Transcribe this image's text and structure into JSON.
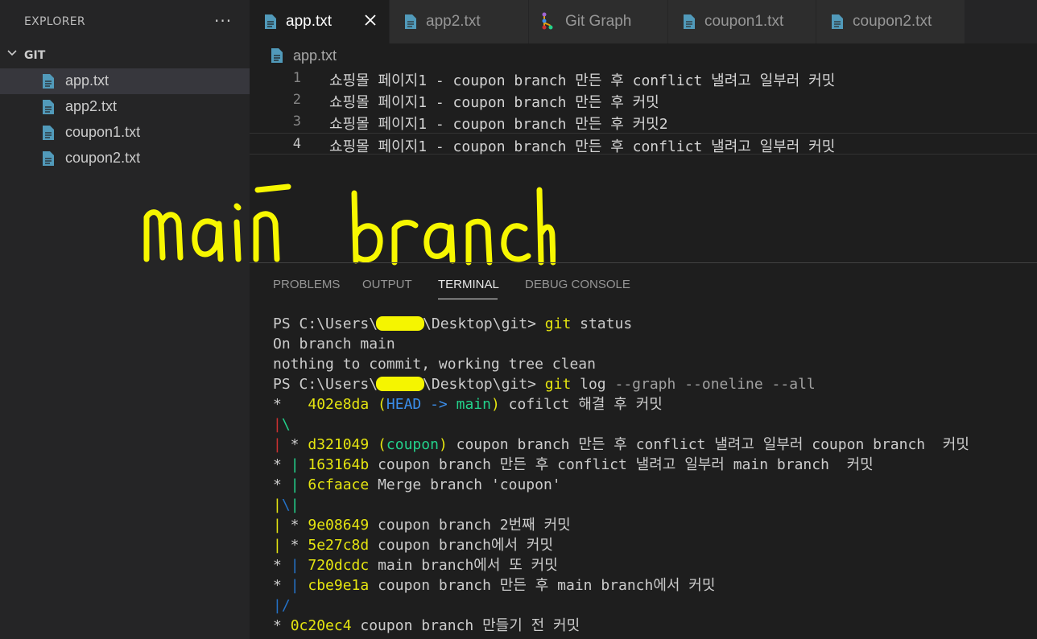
{
  "sidebar": {
    "title": "EXPLORER",
    "more": "···",
    "section": "GIT",
    "files": [
      "app.txt",
      "app2.txt",
      "coupon1.txt",
      "coupon2.txt"
    ]
  },
  "tabs": [
    "app.txt",
    "app2.txt",
    "Git Graph",
    "coupon1.txt",
    "coupon2.txt"
  ],
  "breadcrumb": "app.txt",
  "editor": {
    "lines": [
      {
        "n": "1",
        "text": "쇼핑몰 페이지1 - coupon branch 만든 후 conflict 낼려고 일부러 커밋"
      },
      {
        "n": "2",
        "text": "쇼핑몰 페이지1 - coupon branch 만든 후 커밋"
      },
      {
        "n": "3",
        "text": "쇼핑몰 페이지1 - coupon branch 만든 후 커밋2"
      },
      {
        "n": "4",
        "text": "쇼핑몰 페이지1 - coupon branch 만든 후 conflict 낼려고 일부러 커밋"
      }
    ]
  },
  "panel": {
    "tabs": [
      "PROBLEMS",
      "OUTPUT",
      "TERMINAL",
      "DEBUG CONSOLE"
    ],
    "active": "TERMINAL"
  },
  "terminal": {
    "prompt_pre": "PS C:\\Users\\",
    "prompt_post": "\\Desktop\\git>",
    "cmd1_git": "git",
    "cmd1_rest": " status",
    "out1": "On branch main",
    "out2": "nothing to commit, working tree clean",
    "cmd2_git": "git",
    "cmd2_log": " log",
    "cmd2_rest": " --graph --oneline --all",
    "g1_star": "*   ",
    "g1_hash": "402e8da",
    "g1_open": " (",
    "g1_head": "HEAD -> ",
    "g1_main": "main",
    "g1_close": ")",
    "g1_msg": " cofilct 해결 후 커밋",
    "g2_bar": "|",
    "g2_slash": "\\",
    "g3_bar": "|",
    "g3_star": " * ",
    "g3_hash": "d321049",
    "g3_open": " (",
    "g3_ref": "coupon",
    "g3_close": ")",
    "g3_msg": " coupon branch 만든 후 conflict 낼려고 일부러 coupon branch  커밋",
    "g4_star": "* ",
    "g4_bar": "|",
    "g4_hash": " 163164b",
    "g4_msg": " coupon branch 만든 후 conflict 낼려고 일부러 main branch  커밋",
    "g5_star": "* ",
    "g5_bar": "|",
    "g5_hash": " 6cfaace",
    "g5_msg": " Merge branch 'coupon'",
    "g6_a": "|",
    "g6_b": "\\",
    "g6_c": "|",
    "g7_bar": "|",
    "g7_star": " * ",
    "g7_hash": "9e08649",
    "g7_msg": " coupon branch 2번째 커밋",
    "g8_bar": "|",
    "g8_star": " * ",
    "g8_hash": "5e27c8d",
    "g8_msg": " coupon branch에서 커밋",
    "g9_star": "* ",
    "g9_bar": "|",
    "g9_hash": " 720dcdc",
    "g9_msg": " main branch에서 또 커밋",
    "g10_star": "* ",
    "g10_bar": "|",
    "g10_hash": " cbe9e1a",
    "g10_msg": " coupon branch 만든 후 main branch에서 커밋",
    "g11_bar": "|",
    "g11_slash": "/",
    "g12_star": "* ",
    "g12_hash": "0c20ec4",
    "g12_msg": " coupon branch 만들기 전 커밋"
  },
  "colors": {
    "accent": "#007acc",
    "file_icon": "#519aba",
    "yellow": "#e5e510",
    "green": "#23d18b",
    "blue": "#3b8eea",
    "red": "#cd3131"
  },
  "icons": {
    "file": "file-icon",
    "git_graph": "git-graph-icon",
    "close": "close-icon",
    "chevron": "chevron-down-icon"
  }
}
